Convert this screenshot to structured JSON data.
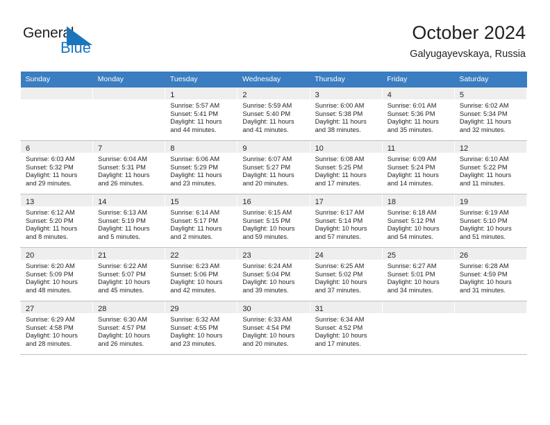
{
  "logo": {
    "text_top": "General",
    "text_bottom": "Blue",
    "flag_icon": "triangle-flag-icon",
    "blue": "#1b75bc"
  },
  "header": {
    "title": "October 2024",
    "subtitle": "Galyugayevskaya, Russia"
  },
  "theme": {
    "header_row_bg": "#3a7dc0",
    "daynum_bg": "#eeeeee",
    "text": "#231f20"
  },
  "weekdays": [
    "Sunday",
    "Monday",
    "Tuesday",
    "Wednesday",
    "Thursday",
    "Friday",
    "Saturday"
  ],
  "weeks": [
    [
      {
        "day": "",
        "lines": []
      },
      {
        "day": "",
        "lines": []
      },
      {
        "day": "1",
        "lines": [
          "Sunrise: 5:57 AM",
          "Sunset: 5:41 PM",
          "Daylight: 11 hours",
          "and 44 minutes."
        ]
      },
      {
        "day": "2",
        "lines": [
          "Sunrise: 5:59 AM",
          "Sunset: 5:40 PM",
          "Daylight: 11 hours",
          "and 41 minutes."
        ]
      },
      {
        "day": "3",
        "lines": [
          "Sunrise: 6:00 AM",
          "Sunset: 5:38 PM",
          "Daylight: 11 hours",
          "and 38 minutes."
        ]
      },
      {
        "day": "4",
        "lines": [
          "Sunrise: 6:01 AM",
          "Sunset: 5:36 PM",
          "Daylight: 11 hours",
          "and 35 minutes."
        ]
      },
      {
        "day": "5",
        "lines": [
          "Sunrise: 6:02 AM",
          "Sunset: 5:34 PM",
          "Daylight: 11 hours",
          "and 32 minutes."
        ]
      }
    ],
    [
      {
        "day": "6",
        "lines": [
          "Sunrise: 6:03 AM",
          "Sunset: 5:32 PM",
          "Daylight: 11 hours",
          "and 29 minutes."
        ]
      },
      {
        "day": "7",
        "lines": [
          "Sunrise: 6:04 AM",
          "Sunset: 5:31 PM",
          "Daylight: 11 hours",
          "and 26 minutes."
        ]
      },
      {
        "day": "8",
        "lines": [
          "Sunrise: 6:06 AM",
          "Sunset: 5:29 PM",
          "Daylight: 11 hours",
          "and 23 minutes."
        ]
      },
      {
        "day": "9",
        "lines": [
          "Sunrise: 6:07 AM",
          "Sunset: 5:27 PM",
          "Daylight: 11 hours",
          "and 20 minutes."
        ]
      },
      {
        "day": "10",
        "lines": [
          "Sunrise: 6:08 AM",
          "Sunset: 5:25 PM",
          "Daylight: 11 hours",
          "and 17 minutes."
        ]
      },
      {
        "day": "11",
        "lines": [
          "Sunrise: 6:09 AM",
          "Sunset: 5:24 PM",
          "Daylight: 11 hours",
          "and 14 minutes."
        ]
      },
      {
        "day": "12",
        "lines": [
          "Sunrise: 6:10 AM",
          "Sunset: 5:22 PM",
          "Daylight: 11 hours",
          "and 11 minutes."
        ]
      }
    ],
    [
      {
        "day": "13",
        "lines": [
          "Sunrise: 6:12 AM",
          "Sunset: 5:20 PM",
          "Daylight: 11 hours",
          "and 8 minutes."
        ]
      },
      {
        "day": "14",
        "lines": [
          "Sunrise: 6:13 AM",
          "Sunset: 5:19 PM",
          "Daylight: 11 hours",
          "and 5 minutes."
        ]
      },
      {
        "day": "15",
        "lines": [
          "Sunrise: 6:14 AM",
          "Sunset: 5:17 PM",
          "Daylight: 11 hours",
          "and 2 minutes."
        ]
      },
      {
        "day": "16",
        "lines": [
          "Sunrise: 6:15 AM",
          "Sunset: 5:15 PM",
          "Daylight: 10 hours",
          "and 59 minutes."
        ]
      },
      {
        "day": "17",
        "lines": [
          "Sunrise: 6:17 AM",
          "Sunset: 5:14 PM",
          "Daylight: 10 hours",
          "and 57 minutes."
        ]
      },
      {
        "day": "18",
        "lines": [
          "Sunrise: 6:18 AM",
          "Sunset: 5:12 PM",
          "Daylight: 10 hours",
          "and 54 minutes."
        ]
      },
      {
        "day": "19",
        "lines": [
          "Sunrise: 6:19 AM",
          "Sunset: 5:10 PM",
          "Daylight: 10 hours",
          "and 51 minutes."
        ]
      }
    ],
    [
      {
        "day": "20",
        "lines": [
          "Sunrise: 6:20 AM",
          "Sunset: 5:09 PM",
          "Daylight: 10 hours",
          "and 48 minutes."
        ]
      },
      {
        "day": "21",
        "lines": [
          "Sunrise: 6:22 AM",
          "Sunset: 5:07 PM",
          "Daylight: 10 hours",
          "and 45 minutes."
        ]
      },
      {
        "day": "22",
        "lines": [
          "Sunrise: 6:23 AM",
          "Sunset: 5:06 PM",
          "Daylight: 10 hours",
          "and 42 minutes."
        ]
      },
      {
        "day": "23",
        "lines": [
          "Sunrise: 6:24 AM",
          "Sunset: 5:04 PM",
          "Daylight: 10 hours",
          "and 39 minutes."
        ]
      },
      {
        "day": "24",
        "lines": [
          "Sunrise: 6:25 AM",
          "Sunset: 5:02 PM",
          "Daylight: 10 hours",
          "and 37 minutes."
        ]
      },
      {
        "day": "25",
        "lines": [
          "Sunrise: 6:27 AM",
          "Sunset: 5:01 PM",
          "Daylight: 10 hours",
          "and 34 minutes."
        ]
      },
      {
        "day": "26",
        "lines": [
          "Sunrise: 6:28 AM",
          "Sunset: 4:59 PM",
          "Daylight: 10 hours",
          "and 31 minutes."
        ]
      }
    ],
    [
      {
        "day": "27",
        "lines": [
          "Sunrise: 6:29 AM",
          "Sunset: 4:58 PM",
          "Daylight: 10 hours",
          "and 28 minutes."
        ]
      },
      {
        "day": "28",
        "lines": [
          "Sunrise: 6:30 AM",
          "Sunset: 4:57 PM",
          "Daylight: 10 hours",
          "and 26 minutes."
        ]
      },
      {
        "day": "29",
        "lines": [
          "Sunrise: 6:32 AM",
          "Sunset: 4:55 PM",
          "Daylight: 10 hours",
          "and 23 minutes."
        ]
      },
      {
        "day": "30",
        "lines": [
          "Sunrise: 6:33 AM",
          "Sunset: 4:54 PM",
          "Daylight: 10 hours",
          "and 20 minutes."
        ]
      },
      {
        "day": "31",
        "lines": [
          "Sunrise: 6:34 AM",
          "Sunset: 4:52 PM",
          "Daylight: 10 hours",
          "and 17 minutes."
        ]
      },
      {
        "day": "",
        "lines": []
      },
      {
        "day": "",
        "lines": []
      }
    ]
  ]
}
